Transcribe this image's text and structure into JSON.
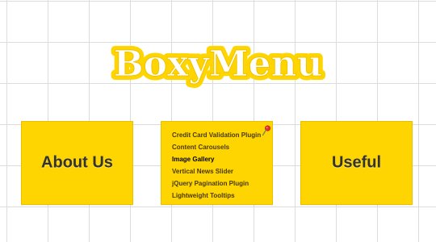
{
  "logo": {
    "text": "BoxyMenu",
    "fill_color": "#ffffff",
    "outline_color": "#fed500"
  },
  "boxes": {
    "about": {
      "label": "About Us"
    },
    "useful": {
      "label": "Useful"
    },
    "projects": {
      "items": [
        {
          "label": "Credit Card Validation Plugin"
        },
        {
          "label": "Content Carousels"
        },
        {
          "label": "Image Gallery"
        },
        {
          "label": "Vertical News Slider"
        },
        {
          "label": "jQuery Pagination Plugin"
        },
        {
          "label": "Lightweight Tooltips"
        }
      ],
      "pin_icon": "pushpin-icon"
    }
  },
  "colors": {
    "box_background": "#fed500",
    "box_text": "#333333",
    "grid_line": "#dcdcdc"
  }
}
